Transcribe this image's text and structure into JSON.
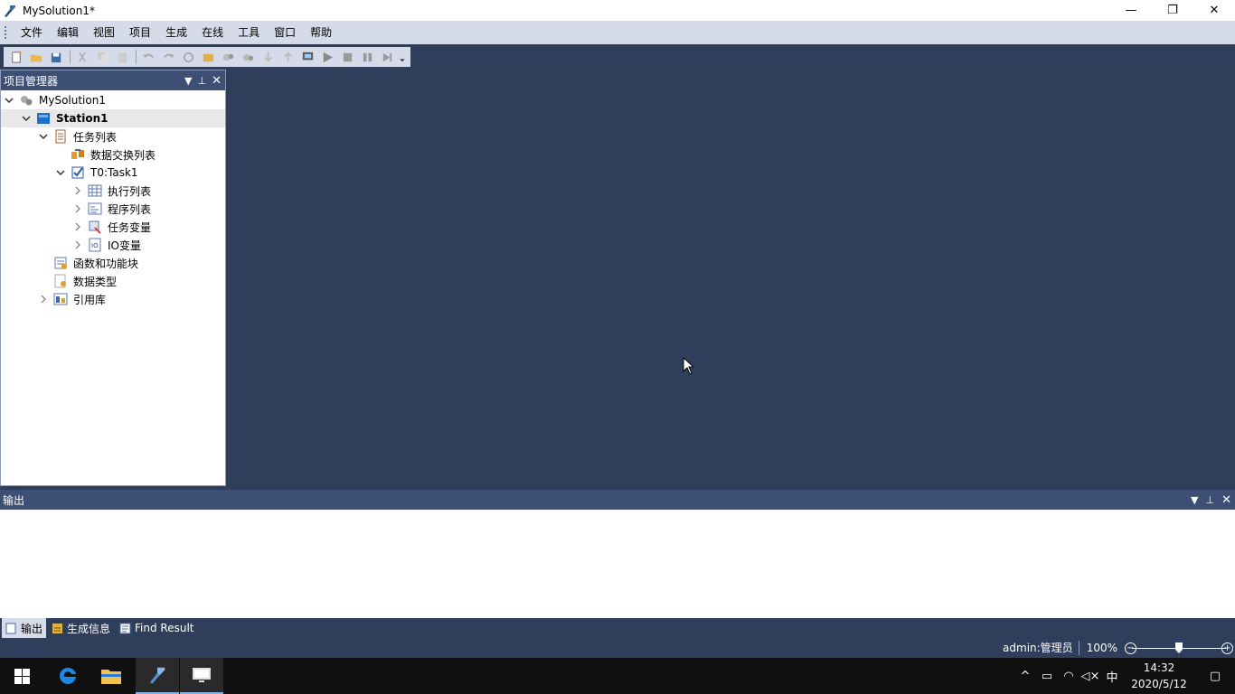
{
  "window": {
    "title": "MySolution1*",
    "minimize": "—",
    "restore": "❐",
    "close": "✕"
  },
  "menu": [
    "文件",
    "编辑",
    "视图",
    "项目",
    "生成",
    "在线",
    "工具",
    "窗口",
    "帮助"
  ],
  "toolbar_icons": [
    "new-file-icon",
    "open-folder-icon",
    "save-all-icon",
    "cut-icon",
    "copy-icon",
    "paste-icon",
    "undo-icon",
    "redo-icon",
    "build-icon",
    "build-all-icon",
    "config-icon",
    "config2-icon",
    "download-icon",
    "upload-icon",
    "monitor-icon",
    "run-icon",
    "stop-icon",
    "pause-icon",
    "step-icon"
  ],
  "project_panel": {
    "title": "项目管理器",
    "tree": [
      {
        "label": "MySolution1",
        "level": 0,
        "expander": "down",
        "icon": "solution-icon"
      },
      {
        "label": "Station1",
        "level": 1,
        "expander": "down",
        "icon": "station-icon",
        "bold": true,
        "selected": true
      },
      {
        "label": "任务列表",
        "level": 2,
        "expander": "down",
        "icon": "tasklist-icon"
      },
      {
        "label": "数据交换列表",
        "level": 3,
        "expander": "",
        "icon": "data-exchange-icon"
      },
      {
        "label": "T0:Task1",
        "level": 3,
        "expander": "down",
        "icon": "task-check-icon"
      },
      {
        "label": "执行列表",
        "level": 4,
        "expander": "right",
        "icon": "grid-icon"
      },
      {
        "label": "程序列表",
        "level": 4,
        "expander": "right",
        "icon": "program-icon"
      },
      {
        "label": "任务变量",
        "level": 4,
        "expander": "right",
        "icon": "variable-icon"
      },
      {
        "label": "IO变量",
        "level": 4,
        "expander": "right",
        "icon": "io-icon"
      },
      {
        "label": "函数和功能块",
        "level": 2,
        "expander": "",
        "icon": "function-block-icon"
      },
      {
        "label": "数据类型",
        "level": 2,
        "expander": "",
        "icon": "datatype-icon"
      },
      {
        "label": "引用库",
        "level": 2,
        "expander": "right",
        "icon": "library-icon"
      }
    ]
  },
  "output_panel": {
    "title": "输出"
  },
  "bottom_tabs": [
    "输出",
    "生成信息",
    "Find Result"
  ],
  "status": {
    "user": "admin:管理员",
    "zoom": "100%",
    "zoom_level_fraction": 0.5
  },
  "taskbar": {
    "time": "14:32",
    "date": "2020/5/12",
    "ime": "中"
  },
  "colors": {
    "background": "#2f3e5b",
    "panel_header": "#3d4f75",
    "menubar": "#d6dbe9"
  }
}
